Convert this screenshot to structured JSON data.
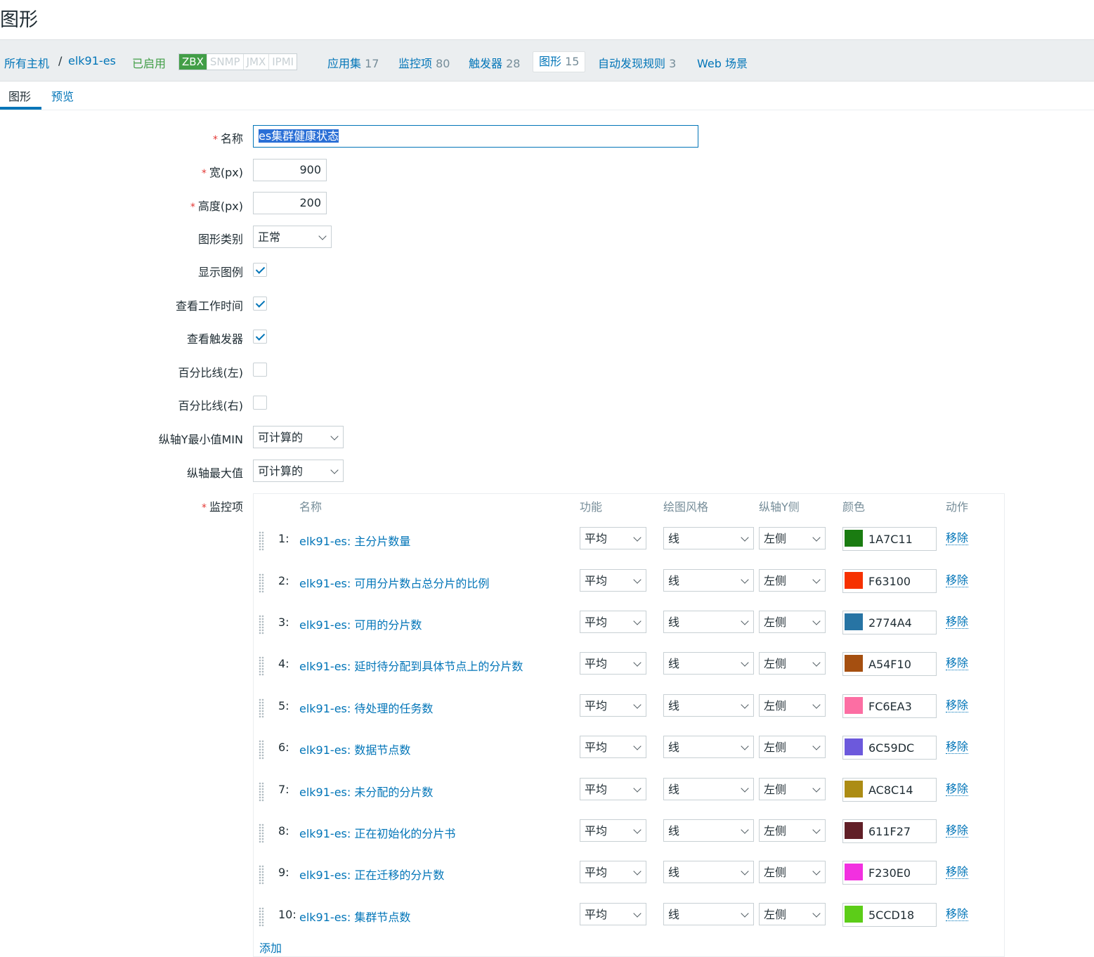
{
  "page_title": "图形",
  "hostbar": {
    "all_hosts": "所有主机",
    "separator": "/",
    "host": "elk91-es",
    "status": "已启用",
    "protocols": [
      "ZBX",
      "SNMP",
      "JMX",
      "IPMI"
    ],
    "links": [
      {
        "label": "应用集",
        "count": "17"
      },
      {
        "label": "监控项",
        "count": "80"
      },
      {
        "label": "触发器",
        "count": "28"
      },
      {
        "label": "图形",
        "count": "15"
      },
      {
        "label": "自动发现规则",
        "count": "3"
      },
      {
        "label": "Web 场景",
        "count": ""
      }
    ]
  },
  "tabs": {
    "graph": "图形",
    "preview": "预览"
  },
  "form": {
    "name_label": "名称",
    "name_value": "es集群健康状态",
    "width_label": "宽(px)",
    "width_value": "900",
    "height_label": "高度(px)",
    "height_value": "200",
    "graph_type_label": "图形类别",
    "graph_type_value": "正常",
    "show_legend_label": "显示图例",
    "show_working_time_label": "查看工作时间",
    "show_triggers_label": "查看触发器",
    "percentile_left_label": "百分比线(左)",
    "percentile_right_label": "百分比线(右)",
    "ymin_label": "纵轴Y最小值MIN",
    "ymin_value": "可计算的",
    "ymax_label": "纵轴最大值",
    "ymax_value": "可计算的",
    "items_label": "监控项",
    "checks": {
      "show_legend": true,
      "show_working_time": true,
      "show_triggers": true,
      "percentile_left": false,
      "percentile_right": false
    }
  },
  "items_table": {
    "headers": {
      "name": "名称",
      "function": "功能",
      "draw_style": "绘图风格",
      "y_side": "纵轴Y侧",
      "color": "颜色",
      "action": "动作"
    },
    "remove_label": "移除",
    "add_label": "添加",
    "rows": [
      {
        "num": "1:",
        "name": "elk91-es: 主分片数量",
        "function": "平均",
        "style": "线",
        "side": "左侧",
        "color": "1A7C11"
      },
      {
        "num": "2:",
        "name": "elk91-es: 可用分片数占总分片的比例",
        "function": "平均",
        "style": "线",
        "side": "左侧",
        "color": "F63100"
      },
      {
        "num": "3:",
        "name": "elk91-es: 可用的分片数",
        "function": "平均",
        "style": "线",
        "side": "左侧",
        "color": "2774A4"
      },
      {
        "num": "4:",
        "name": "elk91-es: 延时待分配到具体节点上的分片数",
        "function": "平均",
        "style": "线",
        "side": "左侧",
        "color": "A54F10"
      },
      {
        "num": "5:",
        "name": "elk91-es: 待处理的任务数",
        "function": "平均",
        "style": "线",
        "side": "左侧",
        "color": "FC6EA3"
      },
      {
        "num": "6:",
        "name": "elk91-es: 数据节点数",
        "function": "平均",
        "style": "线",
        "side": "左侧",
        "color": "6C59DC"
      },
      {
        "num": "7:",
        "name": "elk91-es: 未分配的分片数",
        "function": "平均",
        "style": "线",
        "side": "左侧",
        "color": "AC8C14"
      },
      {
        "num": "8:",
        "name": "elk91-es: 正在初始化的分片书",
        "function": "平均",
        "style": "线",
        "side": "左侧",
        "color": "611F27"
      },
      {
        "num": "9:",
        "name": "elk91-es: 正在迁移的分片数",
        "function": "平均",
        "style": "线",
        "side": "左侧",
        "color": "F230E0"
      },
      {
        "num": "10:",
        "name": "elk91-es: 集群节点数",
        "function": "平均",
        "style": "线",
        "side": "左侧",
        "color": "5CCD18"
      }
    ]
  }
}
